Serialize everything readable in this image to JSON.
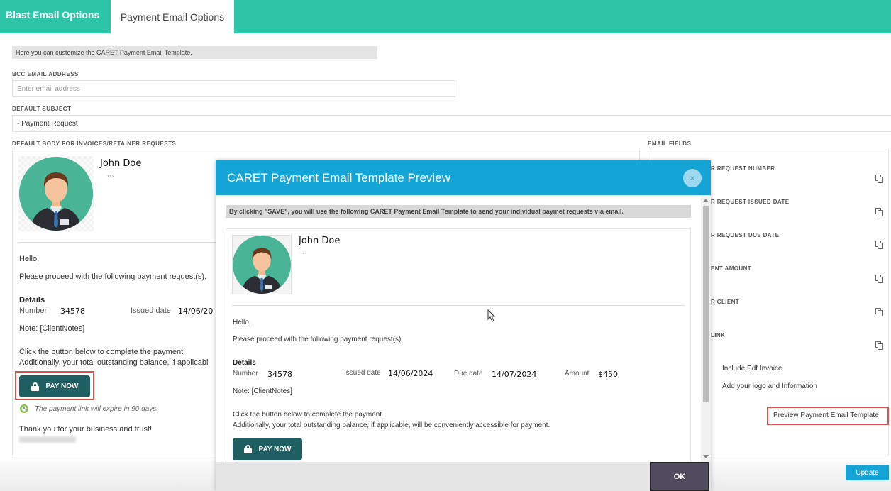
{
  "tabs": [
    {
      "label": "Blast Email Options"
    },
    {
      "label": "Payment Email Options"
    }
  ],
  "info_text": "Here you can customize the CARET Payment Email Template.",
  "bcc": {
    "label": "BCC EMAIL ADDRESS",
    "placeholder": "Enter email address",
    "value": ""
  },
  "subject": {
    "label": "DEFAULT SUBJECT",
    "value": "- Payment Request"
  },
  "body": {
    "label": "DEFAULT BODY FOR INVOICES/RETAINER REQUESTS",
    "name": "John Doe",
    "dots": "ˎˎˎ",
    "hello": "Hello,",
    "proceed": "Please proceed with the following payment request(s).",
    "details": "Details",
    "number_label": "Number",
    "number_value": "34578",
    "issued_label": "Issued date",
    "issued_value": "14/06/20",
    "note": "Note: [ClientNotes]",
    "click_text": "Click the button below to complete the payment.",
    "additional_text": "Additionally, your total outstanding balance, if applicabl",
    "pay_now": "PAY NOW",
    "expire_text": "The payment link will expire in 90 days.",
    "thanks": "Thank you for your business and trust!"
  },
  "email_fields": {
    "label": "EMAIL FIELDS",
    "items": [
      "R REQUEST NUMBER",
      "R REQUEST ISSUED DATE",
      "R REQUEST DUE DATE",
      "ENT AMOUNT",
      "R CLIENT",
      "LINK"
    ],
    "include_pdf": "Include Pdf Invoice",
    "add_logo": "Add your logo and Information",
    "preview_link": "Preview Payment Email Template"
  },
  "modal": {
    "title": "CARET Payment Email Template Preview",
    "close": "×",
    "note": "By clicking \"SAVE\", you will use the following CARET Payment Email Template to send your individual paymet requests via email.",
    "name": "John Doe",
    "dots": "ˎˎˎ",
    "hello": "Hello,",
    "proceed": "Please proceed with the following payment request(s).",
    "details": "Details",
    "number_label": "Number",
    "number_value": "34578",
    "issued_label": "Issued date",
    "issued_value": "14/06/2024",
    "due_label": "Due date",
    "due_value": "14/07/2024",
    "amount_label": "Amount",
    "amount_value": "$450",
    "note_line": "Note: [ClientNotes]",
    "click_text": "Click the button below to complete the payment.",
    "additional_text": "Additionally, your total outstanding balance, if applicable, will be conveniently accessible for payment.",
    "pay_now": "PAY NOW",
    "ok": "OK"
  },
  "update_label": "Update",
  "colors": {
    "accent": "#2ec4a8",
    "modal_header": "#14a4d6",
    "pay_button": "#1f5f62",
    "highlight": "#d9534f"
  }
}
